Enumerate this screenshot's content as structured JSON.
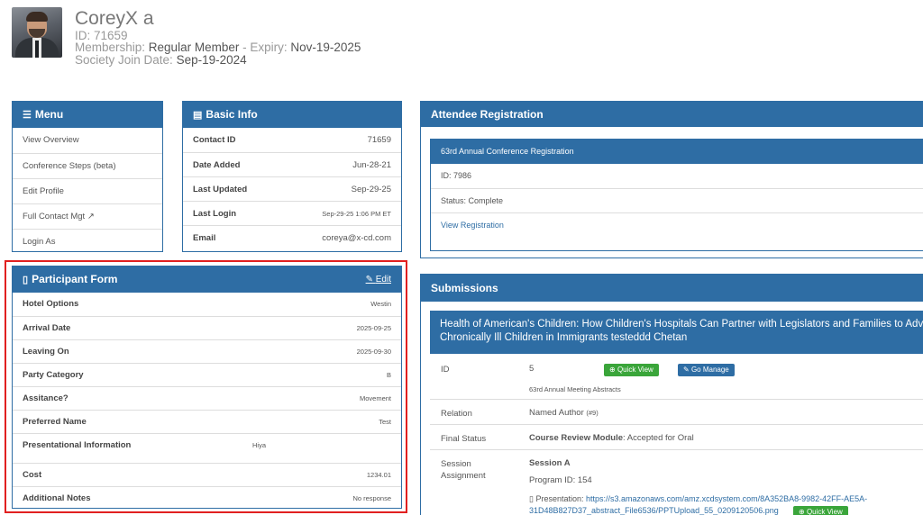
{
  "profile": {
    "name": "CoreyX a",
    "id_line": "ID: 71659",
    "membership_label": "Membership:",
    "membership_value": "Regular Member",
    "expiry_label": " - Expiry:",
    "expiry_value": "Nov-19-2025",
    "society_label": "Society Join Date:",
    "society_value": "Sep-19-2024"
  },
  "menu": {
    "title": "Menu",
    "items": [
      "View Overview",
      "Conference Steps (beta)",
      "Edit Profile",
      "Full Contact Mgt",
      "Login As"
    ]
  },
  "basic_info": {
    "title": "Basic Info",
    "rows": [
      {
        "label": "Contact ID",
        "value": "71659"
      },
      {
        "label": "Date Added",
        "value": "Jun-28-21"
      },
      {
        "label": "Last Updated",
        "value": "Sep-29-25"
      },
      {
        "label": "Last Login",
        "value": "Sep-29-25 1:06 PM ET"
      },
      {
        "label": "Email",
        "value": "coreya@x-cd.com"
      }
    ]
  },
  "participant_form": {
    "title": "Participant Form",
    "edit_label": "Edit",
    "rows": [
      {
        "label": "Hotel Options",
        "value": "Westin"
      },
      {
        "label": "Arrival Date",
        "value": "2025-09-25"
      },
      {
        "label": "Leaving On",
        "value": "2025-09-30"
      },
      {
        "label": "Party Category",
        "value": "B"
      },
      {
        "label": "Assitance?",
        "value": "Movement"
      },
      {
        "label": "Preferred Name",
        "value": "Test"
      },
      {
        "label": "Presentational Information",
        "value": "Hiya"
      },
      {
        "label": "Cost",
        "value": "1234.01"
      },
      {
        "label": "Additional Notes",
        "value": "No response"
      }
    ]
  },
  "attendee": {
    "title": "Attendee Registration",
    "inner_title": "63rd Annual Conference Registration",
    "id_line": "ID: 7986",
    "status_line": "Status: Complete",
    "view_link": "View Registration"
  },
  "submissions": {
    "title": "Submissions",
    "item_title_1": "Health of American's Children: How Children's Hospitals Can Partner with Legislators and Families to Advocate",
    "item_title_2": "Chronically Ill Children in Immigrants testeddd Chetan",
    "id_label": "ID",
    "id_value": "5",
    "quick_view_label": "Quick View",
    "go_manage_label": "Go Manage",
    "meeting": "63rd Annual Meeting Abstracts",
    "relation_label": "Relation",
    "relation_value": "Named Author",
    "relation_num": "(#9)",
    "final_status_label": "Final Status",
    "final_status_module": "Course Review Module",
    "final_status_value": ": Accepted for Oral",
    "session_label": "Session Assignment",
    "session_value": "Session A",
    "program_id": "Program ID: 154",
    "presentation_label": "Presentation:",
    "presentation_link_1": "https://s3.amazonaws.com/amz.xcdsystem.com/8A352BA8-9982-42FF-AE5A-",
    "presentation_link_2": "31D48B827D37_abstract_File6536/PPTUpload_55_0209120506.png",
    "quick_view_label_2": "Quick View"
  }
}
